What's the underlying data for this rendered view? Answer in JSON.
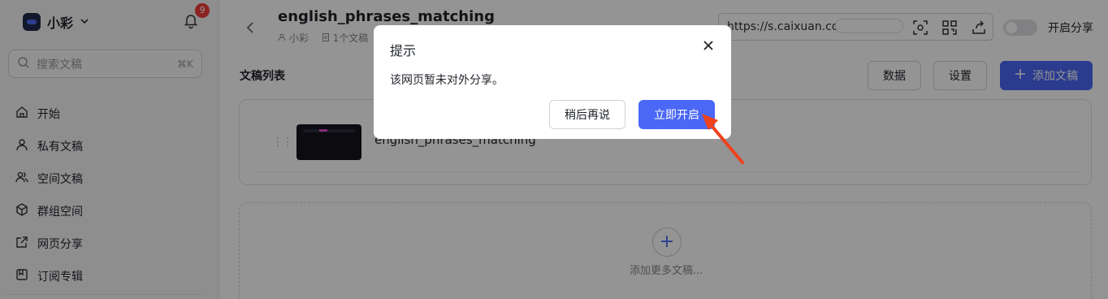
{
  "sidebar": {
    "workspace_name": "小彩",
    "notification_count": "9",
    "search_placeholder": "搜索文稿",
    "search_shortcut": "⌘K",
    "items": [
      {
        "label": "开始",
        "icon": "home-icon"
      },
      {
        "label": "私有文稿",
        "icon": "user-icon"
      },
      {
        "label": "空间文稿",
        "icon": "users-icon"
      },
      {
        "label": "群组空间",
        "icon": "cube-icon"
      },
      {
        "label": "网页分享",
        "icon": "external-link-icon"
      },
      {
        "label": "订阅专辑",
        "icon": "bookmark-icon"
      }
    ]
  },
  "header": {
    "title": "english_phrases_matching",
    "author": "小彩",
    "doc_count": "1个文稿",
    "url": "https://s.caixuan.co",
    "share_toggle_label": "开启分享",
    "share_enabled": false
  },
  "main": {
    "list_title": "文稿列表",
    "data_button": "数据",
    "settings_button": "设置",
    "add_button": "添加文稿",
    "doc_title": "english_phrases_matching",
    "add_more_text": "添加更多文稿..."
  },
  "modal": {
    "title": "提示",
    "message": "该网页暂未对外分享。",
    "cancel_label": "稍后再说",
    "confirm_label": "立即开启"
  },
  "colors": {
    "primary": "#4a67f5",
    "badge": "#f23d3d",
    "annotation_arrow": "#f0421d"
  }
}
